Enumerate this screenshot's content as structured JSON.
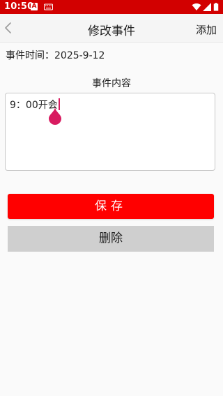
{
  "status_bar": {
    "time": "10:50",
    "a_badge": "A",
    "background_color": "#d20000",
    "icons": [
      "keyboard-icon",
      "wifi-icon",
      "signal-icon",
      "battery-icon"
    ]
  },
  "app_bar": {
    "title": "修改事件",
    "add_label": "添加",
    "back_icon": "chevron-left-icon"
  },
  "event": {
    "time_label": "事件时间：",
    "date": "2025-9-12",
    "content_label": "事件内容",
    "content_value": "9：00开会"
  },
  "actions": {
    "save_label": "保存",
    "delete_label": "删除",
    "save_color": "#ff0000",
    "delete_color": "#cfcfcf",
    "cursor_color": "#d81b60"
  }
}
